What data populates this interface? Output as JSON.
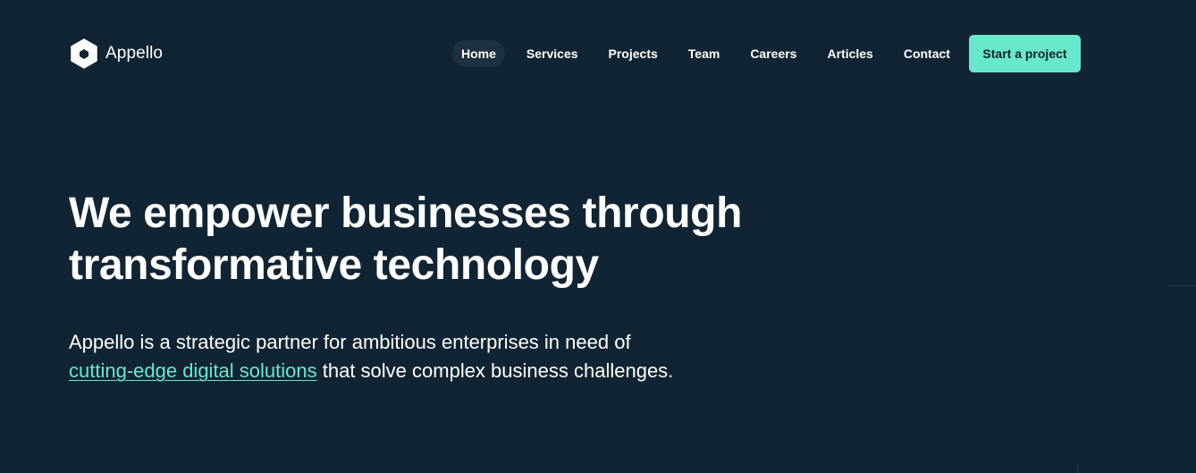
{
  "brand": {
    "name": "Appello",
    "logo_icon": "hexagon-logo-icon"
  },
  "nav": {
    "items": [
      {
        "label": "Home",
        "active": true
      },
      {
        "label": "Services",
        "active": false
      },
      {
        "label": "Projects",
        "active": false
      },
      {
        "label": "Team",
        "active": false
      },
      {
        "label": "Careers",
        "active": false
      },
      {
        "label": "Articles",
        "active": false
      },
      {
        "label": "Contact",
        "active": false
      }
    ],
    "cta_label": "Start a project"
  },
  "hero": {
    "title_line1": "We empower businesses through",
    "title_line2": "transformative technology",
    "desc_line1": "Appello is a strategic partner for ambitious enterprises in need of",
    "desc_link": "cutting-edge digital solutions",
    "desc_line2_rest": " that solve complex business challenges."
  },
  "colors": {
    "background": "#112433",
    "accent": "#67e8cb",
    "nav_active_bg": "#1d3140",
    "text": "#ffffff"
  }
}
